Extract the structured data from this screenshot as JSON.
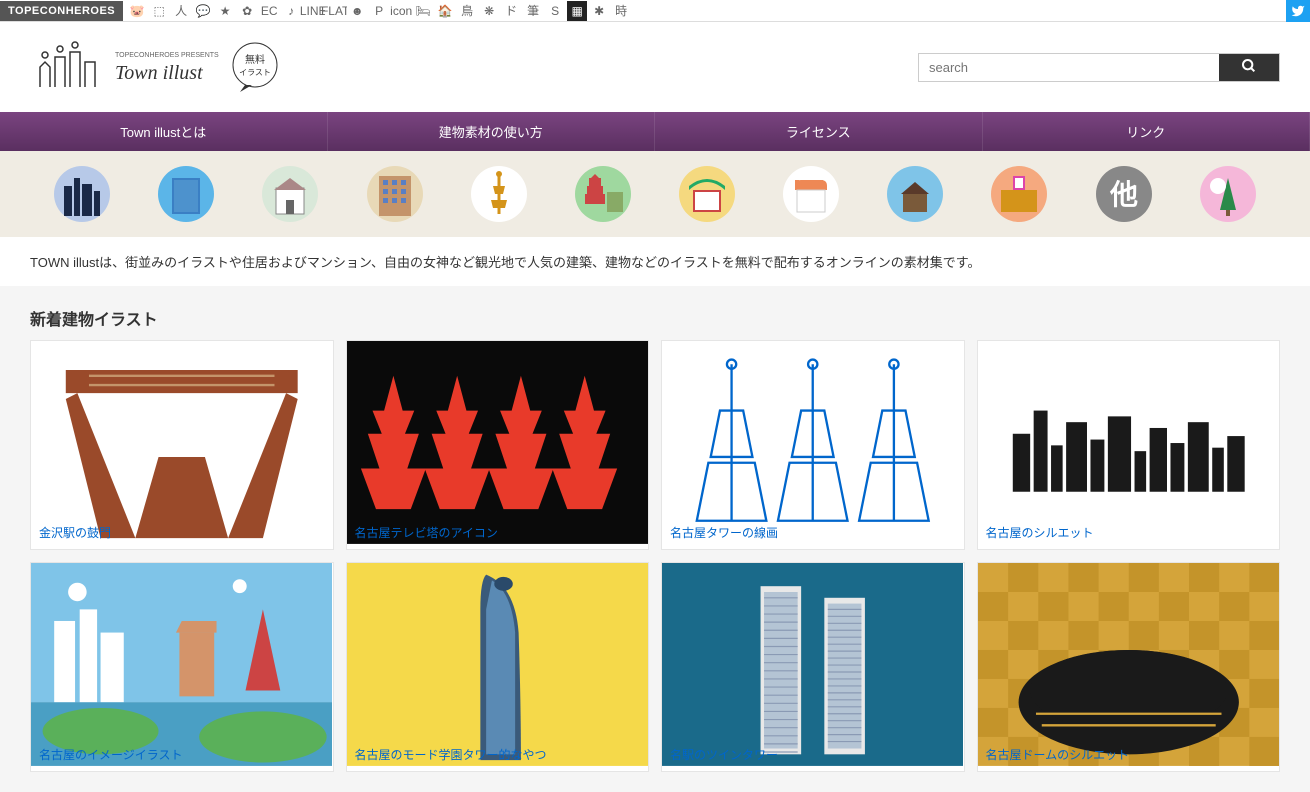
{
  "topbar": {
    "label": "TOPECONHEROES",
    "icons": [
      "🐷",
      "⬚",
      "人",
      "💬",
      "★",
      "✿",
      "EC",
      "♪",
      "LINE",
      "FLAT",
      "☻",
      "P",
      "icon",
      "🛏",
      "🏠",
      "鳥",
      "❋",
      "ド",
      "筆",
      "S",
      "▦",
      "✱",
      "時"
    ],
    "active_index": 20
  },
  "logo": {
    "presents": "TOPECONHEROES PRESENTS",
    "title": "Town illust",
    "badge": "無料イラスト"
  },
  "search": {
    "placeholder": "search"
  },
  "nav": [
    {
      "label": "Town illustとは"
    },
    {
      "label": "建物素材の使い方"
    },
    {
      "label": "ライセンス"
    },
    {
      "label": "リンク"
    }
  ],
  "categories": [
    {
      "name": "cityscape",
      "bg": "#b7c9e8"
    },
    {
      "name": "building",
      "bg": "#5bb5e8"
    },
    {
      "name": "house",
      "bg": "#d9e8d9"
    },
    {
      "name": "apartment",
      "bg": "#e8d9b7"
    },
    {
      "name": "tower",
      "bg": "#ffffff"
    },
    {
      "name": "temple",
      "bg": "#9fd89f"
    },
    {
      "name": "shrine",
      "bg": "#f5d97f"
    },
    {
      "name": "shop",
      "bg": "#ffffff"
    },
    {
      "name": "cabin",
      "bg": "#7fc4e8"
    },
    {
      "name": "school",
      "bg": "#f5a97f"
    },
    {
      "name": "other",
      "bg": "#888888"
    },
    {
      "name": "nature",
      "bg": "#f5b7d9"
    }
  ],
  "description": "TOWN illustは、街並みのイラストや住居およびマンション、自由の女神など観光地で人気の建築、建物などのイラストを無料で配布するオンラインの素材集です。",
  "section_title": "新着建物イラスト",
  "items": [
    {
      "title": "金沢駅の鼓門"
    },
    {
      "title": "名古屋テレビ塔のアイコン"
    },
    {
      "title": "名古屋タワーの線画"
    },
    {
      "title": "名古屋のシルエット"
    },
    {
      "title": "名古屋のイメージイラスト"
    },
    {
      "title": "名古屋のモード学園タワー的なやつ"
    },
    {
      "title": "名駅のツインタワー"
    },
    {
      "title": "名古屋ドームのシルエット"
    }
  ]
}
